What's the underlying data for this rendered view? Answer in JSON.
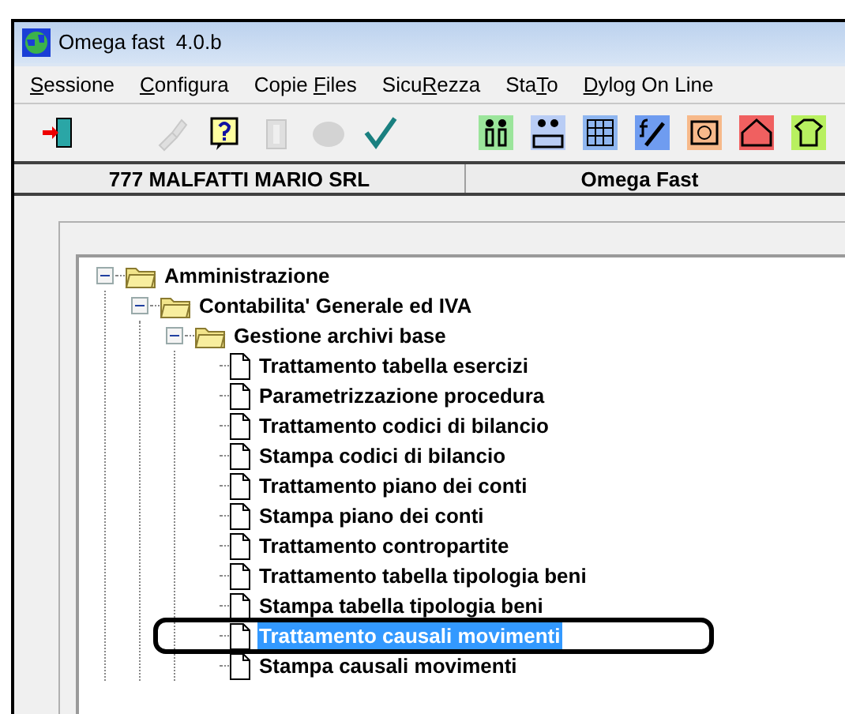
{
  "window": {
    "title": "Omega fast  4.0.b"
  },
  "menu": [
    {
      "key": "S",
      "after": "essione"
    },
    {
      "key": "C",
      "after": "onfigura"
    },
    {
      "before": "Copie ",
      "key": "F",
      "after": "iles"
    },
    {
      "before": "Sicu",
      "key": "R",
      "after": "ezza"
    },
    {
      "before": "Sta",
      "key": "T",
      "after": "o"
    },
    {
      "key": "D",
      "after": "ylog On Line"
    }
  ],
  "toolbar": {
    "left": [
      {
        "kind": "exit",
        "disabled": false
      }
    ],
    "middle": [
      {
        "kind": "brush",
        "disabled": true
      },
      {
        "kind": "help",
        "disabled": false
      },
      {
        "kind": "bin",
        "disabled": true
      },
      {
        "kind": "blob",
        "disabled": true
      },
      {
        "kind": "check",
        "disabled": false
      }
    ],
    "right": [
      {
        "kind": "people",
        "disabled": false
      },
      {
        "kind": "desk",
        "disabled": false
      },
      {
        "kind": "grid",
        "disabled": false
      },
      {
        "kind": "tools",
        "disabled": false
      },
      {
        "kind": "money",
        "disabled": false
      },
      {
        "kind": "house",
        "disabled": false
      },
      {
        "kind": "shirt",
        "disabled": false
      }
    ]
  },
  "header": {
    "company": "777 MALFATTI MARIO SRL",
    "product": "Omega Fast"
  },
  "tree": [
    {
      "label": "Amministrazione",
      "kind": "folder",
      "expanded": true,
      "selected": false,
      "children": [
        {
          "label": "Contabilita' Generale ed IVA",
          "kind": "folder",
          "expanded": true,
          "selected": false,
          "children": [
            {
              "label": "Gestione archivi base",
              "kind": "folder",
              "expanded": true,
              "selected": false,
              "children": [
                {
                  "label": "Trattamento tabella esercizi",
                  "kind": "document",
                  "selected": false
                },
                {
                  "label": "Parametrizzazione procedura",
                  "kind": "document",
                  "selected": false
                },
                {
                  "label": "Trattamento codici di bilancio",
                  "kind": "document",
                  "selected": false
                },
                {
                  "label": "Stampa codici di bilancio",
                  "kind": "document",
                  "selected": false
                },
                {
                  "label": "Trattamento piano dei conti",
                  "kind": "document",
                  "selected": false
                },
                {
                  "label": "Stampa piano dei conti",
                  "kind": "document",
                  "selected": false
                },
                {
                  "label": "Trattamento contropartite",
                  "kind": "document",
                  "selected": false
                },
                {
                  "label": "Trattamento tabella tipologia beni",
                  "kind": "document",
                  "selected": false
                },
                {
                  "label": "Stampa tabella tipologia beni",
                  "kind": "document",
                  "selected": false
                },
                {
                  "label": "Trattamento causali movimenti",
                  "kind": "document",
                  "selected": true
                },
                {
                  "label": "Stampa causali movimenti",
                  "kind": "document",
                  "selected": false
                }
              ]
            }
          ]
        }
      ]
    }
  ]
}
